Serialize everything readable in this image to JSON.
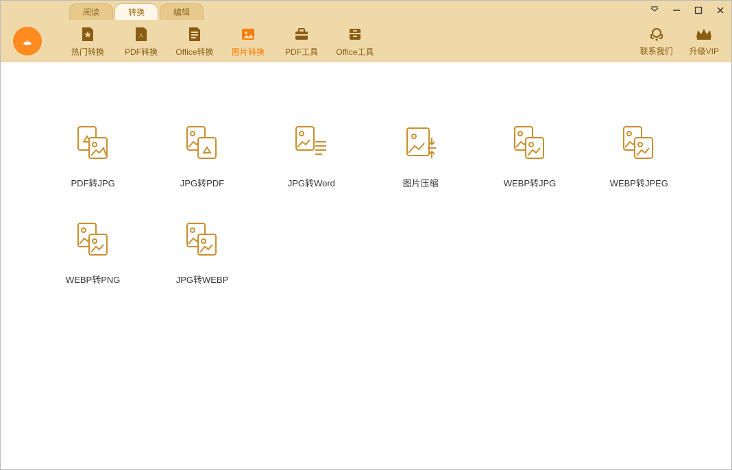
{
  "tabs": {
    "read": "阅读",
    "convert": "转换",
    "edit": "编辑"
  },
  "toolbar": {
    "hot": "热门转换",
    "pdf": "PDF转换",
    "office": "Office转换",
    "image": "图片转换",
    "pdftool": "PDF工具",
    "officetool": "Office工具",
    "contact": "联系我们",
    "vip": "升级VIP"
  },
  "functions": [
    {
      "label": "PDF转JPG"
    },
    {
      "label": "JPG转PDF"
    },
    {
      "label": "JPG转Word"
    },
    {
      "label": "图片压缩"
    },
    {
      "label": "WEBP转JPG"
    },
    {
      "label": "WEBP转JPEG"
    },
    {
      "label": "WEBP转PNG"
    },
    {
      "label": "JPG转WEBP"
    }
  ],
  "colors": {
    "accent": "#c98f2f",
    "highlight": "#ff7a00"
  }
}
